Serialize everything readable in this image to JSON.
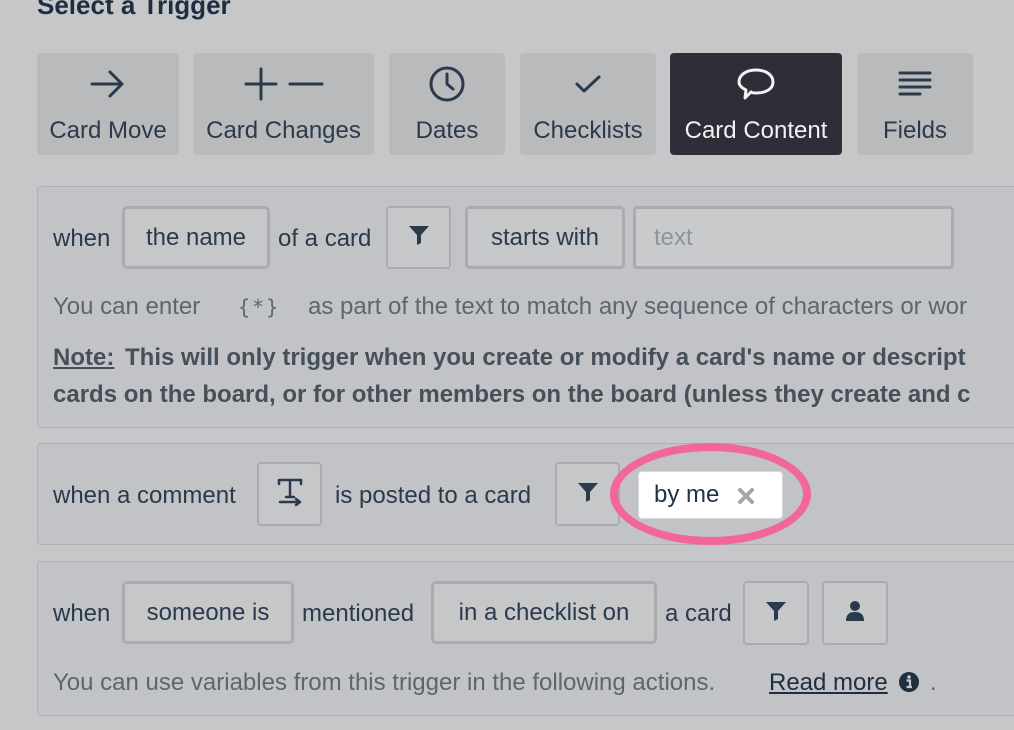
{
  "heading": "Select a Trigger",
  "tabs": [
    {
      "label": "Card Move",
      "icon": "arrow-right-icon"
    },
    {
      "label": "Card Changes",
      "icon": "plus-minus-icon"
    },
    {
      "label": "Dates",
      "icon": "clock-icon"
    },
    {
      "label": "Checklists",
      "icon": "checkmark-icon"
    },
    {
      "label": "Card Content",
      "icon": "speech-bubble-icon",
      "active": true
    },
    {
      "label": "Fields",
      "icon": "lines-icon"
    }
  ],
  "trigger1": {
    "when": "when",
    "field_button": "the name",
    "of_a_card": "of a card",
    "operator_button": "starts with",
    "text_placeholder": "text",
    "hint_prefix": "You can enter",
    "hint_token": "{*}",
    "hint_suffix": "as part of the text to match any sequence of characters or wor",
    "note_label": "Note:",
    "note_line1": "This will only trigger when you create or modify a card's name or descript",
    "note_line2": "cards on the board, or for other members on the board (unless they create and c"
  },
  "trigger2": {
    "when_a_comment": "when a comment",
    "is_posted": "is posted to a card",
    "tag_label": "by me"
  },
  "trigger3": {
    "when": "when",
    "who_button": "someone is",
    "mentioned": "mentioned",
    "where_button": "in a checklist on",
    "a_card": "a card",
    "hint_text": "You can use variables from this trigger in the following actions.",
    "read_more": "Read more",
    "period": "."
  },
  "colors": {
    "overlay_bg": "#c6c7c9",
    "active_tab": "#2e2d38",
    "highlight_ring": "#f2669c"
  }
}
